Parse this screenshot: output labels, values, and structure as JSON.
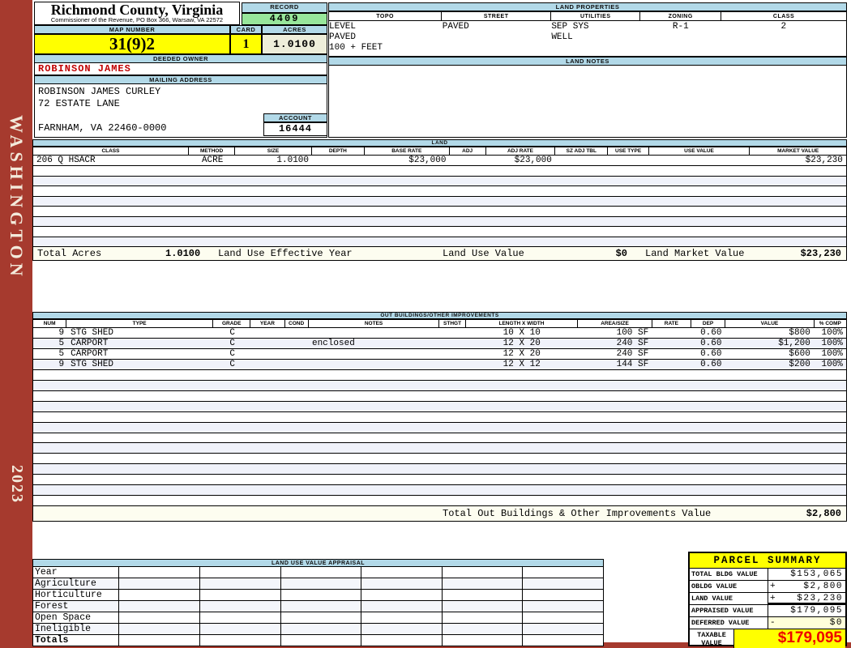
{
  "header": {
    "title": "Richmond County, Virginia",
    "subtitle": "Commissioner of the Revenue, PO Box 366, Warsaw, VA 22572"
  },
  "sidebar": {
    "district": "WASHINGTON",
    "year": "2023"
  },
  "record": {
    "label": "RECORD",
    "value": "4409"
  },
  "map_number": {
    "label": "MAP NUMBER",
    "value": "31(9)2"
  },
  "card": {
    "label": "CARD",
    "value": "1"
  },
  "acres": {
    "label": "ACRES",
    "value": "1.0100"
  },
  "land_properties": {
    "title": "LAND PROPERTIES",
    "headers": [
      "TOPO",
      "STREET",
      "UTILITIES",
      "ZONING",
      "CLASS"
    ],
    "topo": [
      "LEVEL",
      "PAVED",
      "100 + FEET"
    ],
    "street": "PAVED",
    "utilities": [
      "SEP SYS",
      "WELL"
    ],
    "zoning": "R-1",
    "class": "2"
  },
  "owner": {
    "deeded_owner_label": "DEEDED OWNER",
    "name": "ROBINSON JAMES",
    "mailing_address_label": "MAILING ADDRESS",
    "line1": "ROBINSON JAMES CURLEY",
    "line2": "72 ESTATE LANE",
    "line3": "FARNHAM, VA 22460-0000"
  },
  "account": {
    "label": "ACCOUNT",
    "value": "16444"
  },
  "land_notes": {
    "title": "LAND NOTES"
  },
  "land": {
    "title": "LAND",
    "headers": [
      "CLASS",
      "METHOD",
      "SIZE",
      "DEPTH",
      "BASE RATE",
      "ADJ",
      "ADJ RATE",
      "SZ ADJ TBL",
      "USE TYPE",
      "USE VALUE",
      "MARKET VALUE"
    ],
    "row": {
      "class": "206 Q HSACR",
      "method": "ACRE",
      "size": "1.0100",
      "depth": "",
      "base_rate": "$23,000",
      "adj": "",
      "adj_rate": "$23,000",
      "sz_adj_tbl": "",
      "use_type": "",
      "use_value": "",
      "market_value": "$23,230"
    },
    "totals": {
      "total_acres_label": "Total Acres",
      "total_acres": "1.0100",
      "effective_year_label": "Land Use Effective Year",
      "use_value_label": "Land Use Value",
      "use_value": "$0",
      "market_value_label": "Land Market Value",
      "market_value": "$23,230"
    }
  },
  "out_buildings": {
    "title": "OUT BUILDINGS/OTHER IMPROVEMENTS",
    "headers": [
      "NUM",
      "TYPE",
      "GRADE",
      "YEAR",
      "COND",
      "NOTES",
      "STHGT",
      "LENGTH X WIDTH",
      "AREA/SIZE",
      "RATE",
      "DEP",
      "VALUE",
      "% COMP"
    ],
    "rows": [
      {
        "num": "9",
        "type": "STG SHED",
        "grade": "C",
        "year": "",
        "cond": "",
        "notes": "",
        "sthgt": "",
        "dims": "10 X 10",
        "area": "100 SF",
        "rate": "",
        "dep": "0.60",
        "value": "$800",
        "comp": "100%"
      },
      {
        "num": "5",
        "type": "CARPORT",
        "grade": "C",
        "year": "",
        "cond": "",
        "notes": "enclosed",
        "sthgt": "",
        "dims": "12 X 20",
        "area": "240 SF",
        "rate": "",
        "dep": "0.60",
        "value": "$1,200",
        "comp": "100%"
      },
      {
        "num": "5",
        "type": "CARPORT",
        "grade": "C",
        "year": "",
        "cond": "",
        "notes": "",
        "sthgt": "",
        "dims": "12 X 20",
        "area": "240 SF",
        "rate": "",
        "dep": "0.60",
        "value": "$600",
        "comp": "100%"
      },
      {
        "num": "9",
        "type": "STG SHED",
        "grade": "C",
        "year": "",
        "cond": "",
        "notes": "",
        "sthgt": "",
        "dims": "12 X 12",
        "area": "144 SF",
        "rate": "",
        "dep": "0.60",
        "value": "$200",
        "comp": "100%"
      }
    ],
    "total_label": "Total Out Buildings & Other Improvements Value",
    "total_value": "$2,800"
  },
  "land_use_appraisal": {
    "title": "LAND USE VALUE APPRAISAL",
    "row_labels": [
      "Year",
      "Agriculture",
      "Horticulture",
      "Forest",
      "Open Space",
      "Ineligible",
      "Totals"
    ]
  },
  "parcel_summary": {
    "title": "PARCEL SUMMARY",
    "rows": [
      {
        "label": "TOTAL BLDG VALUE",
        "op": "",
        "value": "$153,065"
      },
      {
        "label": "OBLDG VALUE",
        "op": "+",
        "value": "$2,800"
      },
      {
        "label": "LAND VALUE",
        "op": "+",
        "value": "$23,230"
      },
      {
        "label": "APPRAISED VALUE",
        "op": "",
        "value": "$179,095"
      },
      {
        "label": "DEFERRED VALUE",
        "op": "-",
        "value": "$0"
      }
    ],
    "taxable": {
      "label_line1": "TAXABLE",
      "label_line2": "VALUE",
      "value": "$179,095"
    }
  },
  "colors": {
    "sidebar_red": "#A63A2E",
    "header_blue": "#B2D9E8",
    "record_green": "#98E69B",
    "highlight_yellow": "#FFFF00",
    "acres_cream": "#EEEEDA",
    "owner_red": "#C00000",
    "taxable_red": "#EE0000"
  }
}
